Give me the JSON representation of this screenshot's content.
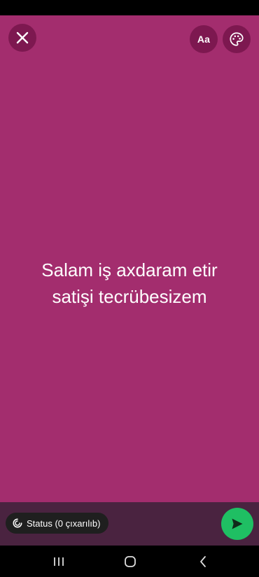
{
  "editor": {
    "background_color": "#a32d6e",
    "font_button_label": "Aa",
    "message_lines": [
      "Salam iş axdaram etir",
      "satişi tecrübesizem"
    ]
  },
  "bottom_bar": {
    "status_label": "Status (0 çıxarılıb)",
    "send_icon": "send-icon",
    "accent": "#1fbf63"
  },
  "icons": {
    "close": "close-icon",
    "palette": "palette-icon",
    "status": "status-icon"
  }
}
